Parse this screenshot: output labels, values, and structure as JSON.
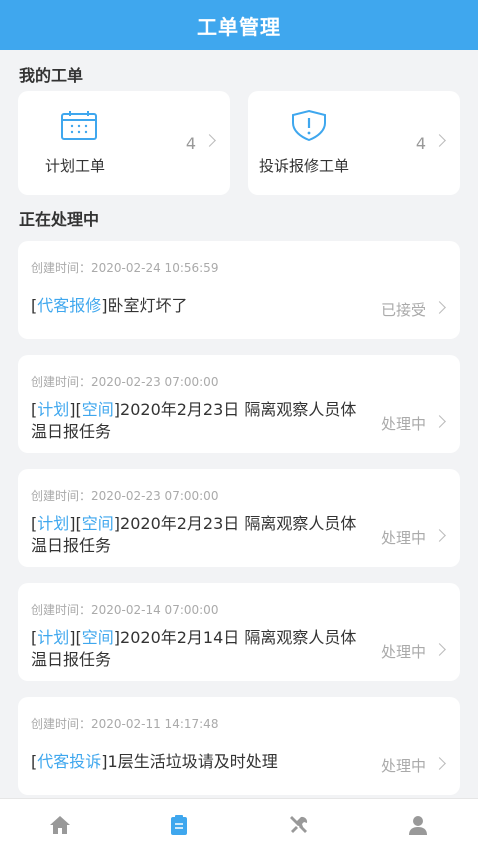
{
  "header": {
    "title": "工单管理"
  },
  "my_orders": {
    "title": "我的工单",
    "cards": [
      {
        "label": "计划工单",
        "count": "4",
        "icon": "calendar-icon"
      },
      {
        "label": "投诉报修工单",
        "count": "4",
        "icon": "shield-alert-icon"
      }
    ]
  },
  "processing": {
    "title": "正在处理中",
    "items": [
      {
        "time": "创建时间：2020-02-24 10:56:59",
        "tags": [
          "代客报修"
        ],
        "text": "卧室灯坏了",
        "status": "已接受"
      },
      {
        "time": "创建时间：2020-02-23 07:00:00",
        "tags": [
          "计划",
          "空间"
        ],
        "text": "2020年2月23日 隔离观察人员体温日报任务",
        "status": "处理中"
      },
      {
        "time": "创建时间：2020-02-23 07:00:00",
        "tags": [
          "计划",
          "空间"
        ],
        "text": "2020年2月23日 隔离观察人员体温日报任务",
        "status": "处理中"
      },
      {
        "time": "创建时间：2020-02-14 07:00:00",
        "tags": [
          "计划",
          "空间"
        ],
        "text": "2020年2月14日 隔离观察人员体温日报任务",
        "status": "处理中"
      },
      {
        "time": "创建时间：2020-02-11 14:17:48",
        "tags": [
          "代客投诉"
        ],
        "text": "1层生活垃圾请及时处理",
        "status": "处理中"
      }
    ]
  },
  "tabbar": {
    "tabs": [
      {
        "icon": "home-icon",
        "active": false
      },
      {
        "icon": "clipboard-icon",
        "active": true
      },
      {
        "icon": "tools-icon",
        "active": false
      },
      {
        "icon": "user-icon",
        "active": false
      }
    ],
    "active_color": "#3fa7ee",
    "inactive_color": "#999999"
  }
}
